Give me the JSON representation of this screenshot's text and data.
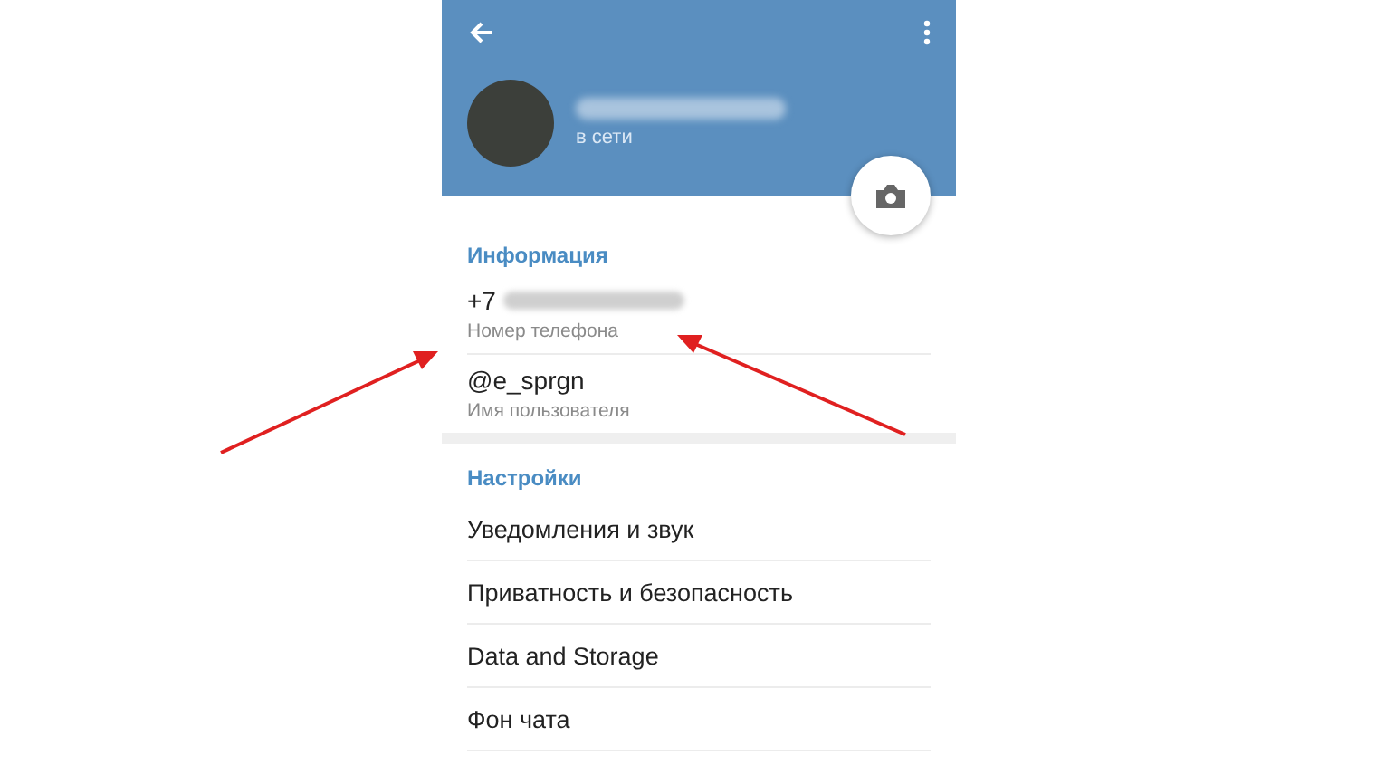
{
  "header": {
    "name_redacted": true,
    "status": "в сети"
  },
  "info": {
    "title": "Информация",
    "rows": [
      {
        "value": "+7",
        "hint": "Номер телефона",
        "redacted": true
      },
      {
        "value": "@e_sprgn",
        "hint": "Имя пользователя",
        "redacted": false
      }
    ]
  },
  "settings": {
    "title": "Настройки",
    "items": [
      "Уведомления и звук",
      "Приватность и безопасность",
      "Data and Storage",
      "Фон чата"
    ]
  }
}
